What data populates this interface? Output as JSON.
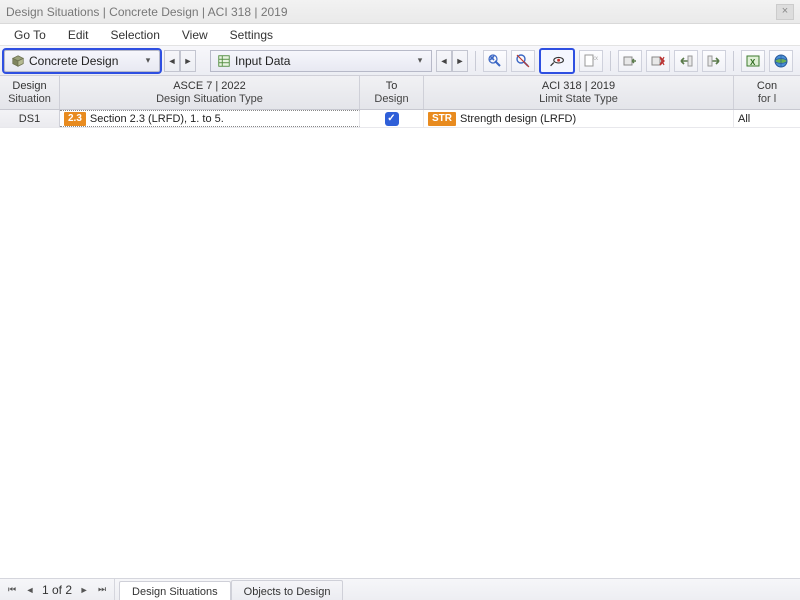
{
  "title": "Design Situations | Concrete Design | ACI 318 | 2019",
  "menu": [
    "Go To",
    "Edit",
    "Selection",
    "View",
    "Settings"
  ],
  "toolbar": {
    "design_dropdown": "Concrete Design",
    "input_dropdown": "Input Data"
  },
  "header": {
    "sit1": "Design",
    "sit2": "Situation",
    "type_top": "ASCE 7 | 2022",
    "type_bot": "Design Situation Type",
    "todesign1": "To",
    "todesign2": "Design",
    "limit_top": "ACI 318 | 2019",
    "limit_bot": "Limit State Type",
    "last1": "Con",
    "last2": "for l"
  },
  "row": {
    "sit": "DS1",
    "badge1": "2.3",
    "type_text": "Section 2.3 (LRFD), 1. to 5.",
    "badge2": "STR",
    "limit_text": "Strength design (LRFD)",
    "last": "All"
  },
  "pager": {
    "text": "1 of 2"
  },
  "tabs": [
    "Design Situations",
    "Objects to Design"
  ]
}
